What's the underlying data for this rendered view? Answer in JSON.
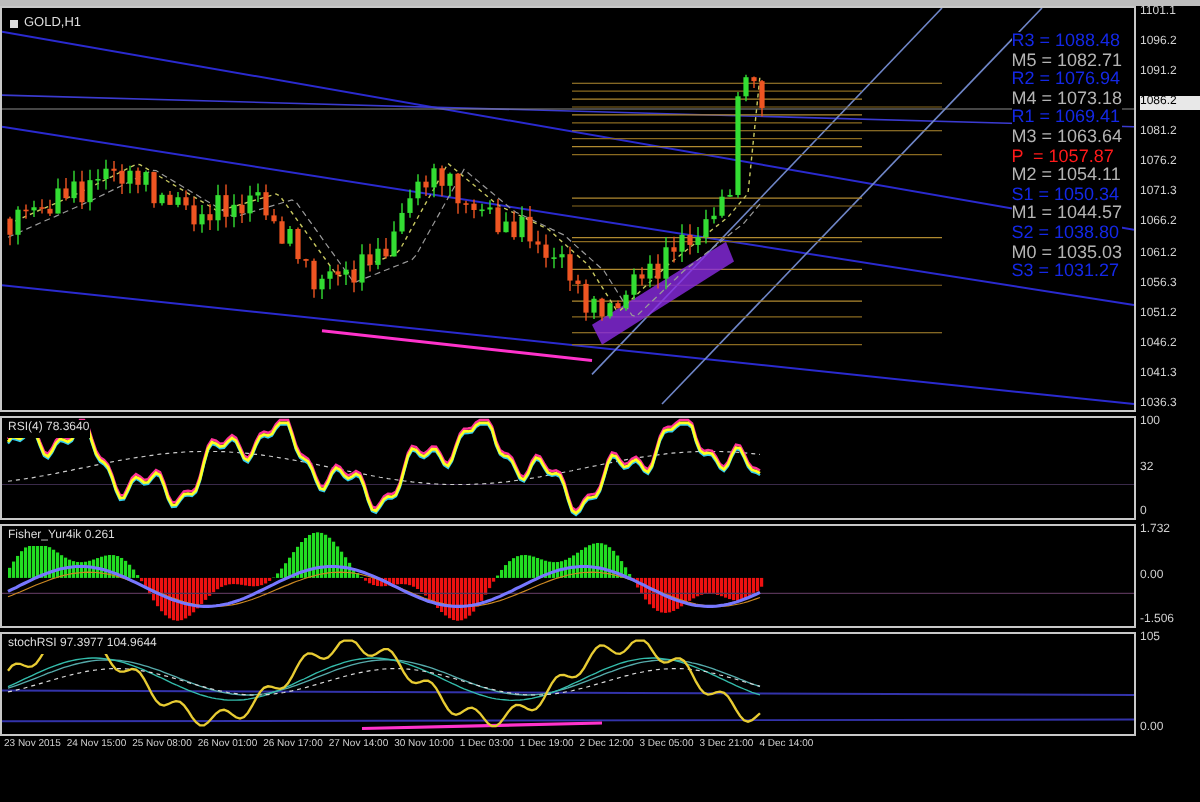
{
  "chart": {
    "symbol": "GOLD,H1",
    "pivots": [
      {
        "text": "R3 = 1088.48",
        "kind": "resistance"
      },
      {
        "text": "M5 = 1082.71",
        "kind": "mid"
      },
      {
        "text": "R2 = 1076.94",
        "kind": "resistance"
      },
      {
        "text": "M4 = 1073.18",
        "kind": "mid"
      },
      {
        "text": "R1 = 1069.41",
        "kind": "resistance"
      },
      {
        "text": "M3 = 1063.64",
        "kind": "mid"
      },
      {
        "text": "P  = 1057.87",
        "kind": "pivot"
      },
      {
        "text": "M2 = 1054.11",
        "kind": "mid"
      },
      {
        "text": "S1 = 1050.34",
        "kind": "support"
      },
      {
        "text": "M1 = 1044.57",
        "kind": "mid"
      },
      {
        "text": "S2 = 1038.80",
        "kind": "support"
      },
      {
        "text": "M0 = 1035.03",
        "kind": "mid"
      },
      {
        "text": "S3 = 1031.27",
        "kind": "support"
      }
    ],
    "price_axis": [
      {
        "label": "1101.1",
        "highlighted": false
      },
      {
        "label": "1096.2",
        "highlighted": false
      },
      {
        "label": "1091.2",
        "highlighted": false
      },
      {
        "label": "1086.2",
        "highlighted": true
      },
      {
        "label": "1081.2",
        "highlighted": false
      },
      {
        "label": "1076.2",
        "highlighted": false
      },
      {
        "label": "1071.3",
        "highlighted": false
      },
      {
        "label": "1066.2",
        "highlighted": false
      },
      {
        "label": "1061.2",
        "highlighted": false
      },
      {
        "label": "1056.3",
        "highlighted": false
      },
      {
        "label": "1051.2",
        "highlighted": false
      },
      {
        "label": "1046.2",
        "highlighted": false
      },
      {
        "label": "1041.3",
        "highlighted": false
      },
      {
        "label": "1036.3",
        "highlighted": false
      }
    ]
  },
  "indicators": [
    {
      "label": "RSI(4) 78.3640",
      "kind": "rsi",
      "axis": [
        "100",
        "32",
        "0"
      ]
    },
    {
      "label": "Fisher_Yur4ik 0.261",
      "kind": "histogram",
      "axis": [
        "1.732",
        "0.00",
        "-1.506"
      ]
    },
    {
      "label": "stochRSI 97.3977 104.9644",
      "kind": "stoch",
      "axis": [
        "105",
        "0.00"
      ]
    }
  ],
  "time_axis": [
    "23 Nov 2015",
    "24 Nov 15:00",
    "25 Nov 08:00",
    "26 Nov 01:00",
    "26 Nov 17:00",
    "27 Nov 14:00",
    "30 Nov 10:00",
    "1 Dec 03:00",
    "1 Dec 19:00",
    "2 Dec 12:00",
    "3 Dec 05:00",
    "3 Dec 21:00",
    "4 Dec 14:00"
  ]
}
